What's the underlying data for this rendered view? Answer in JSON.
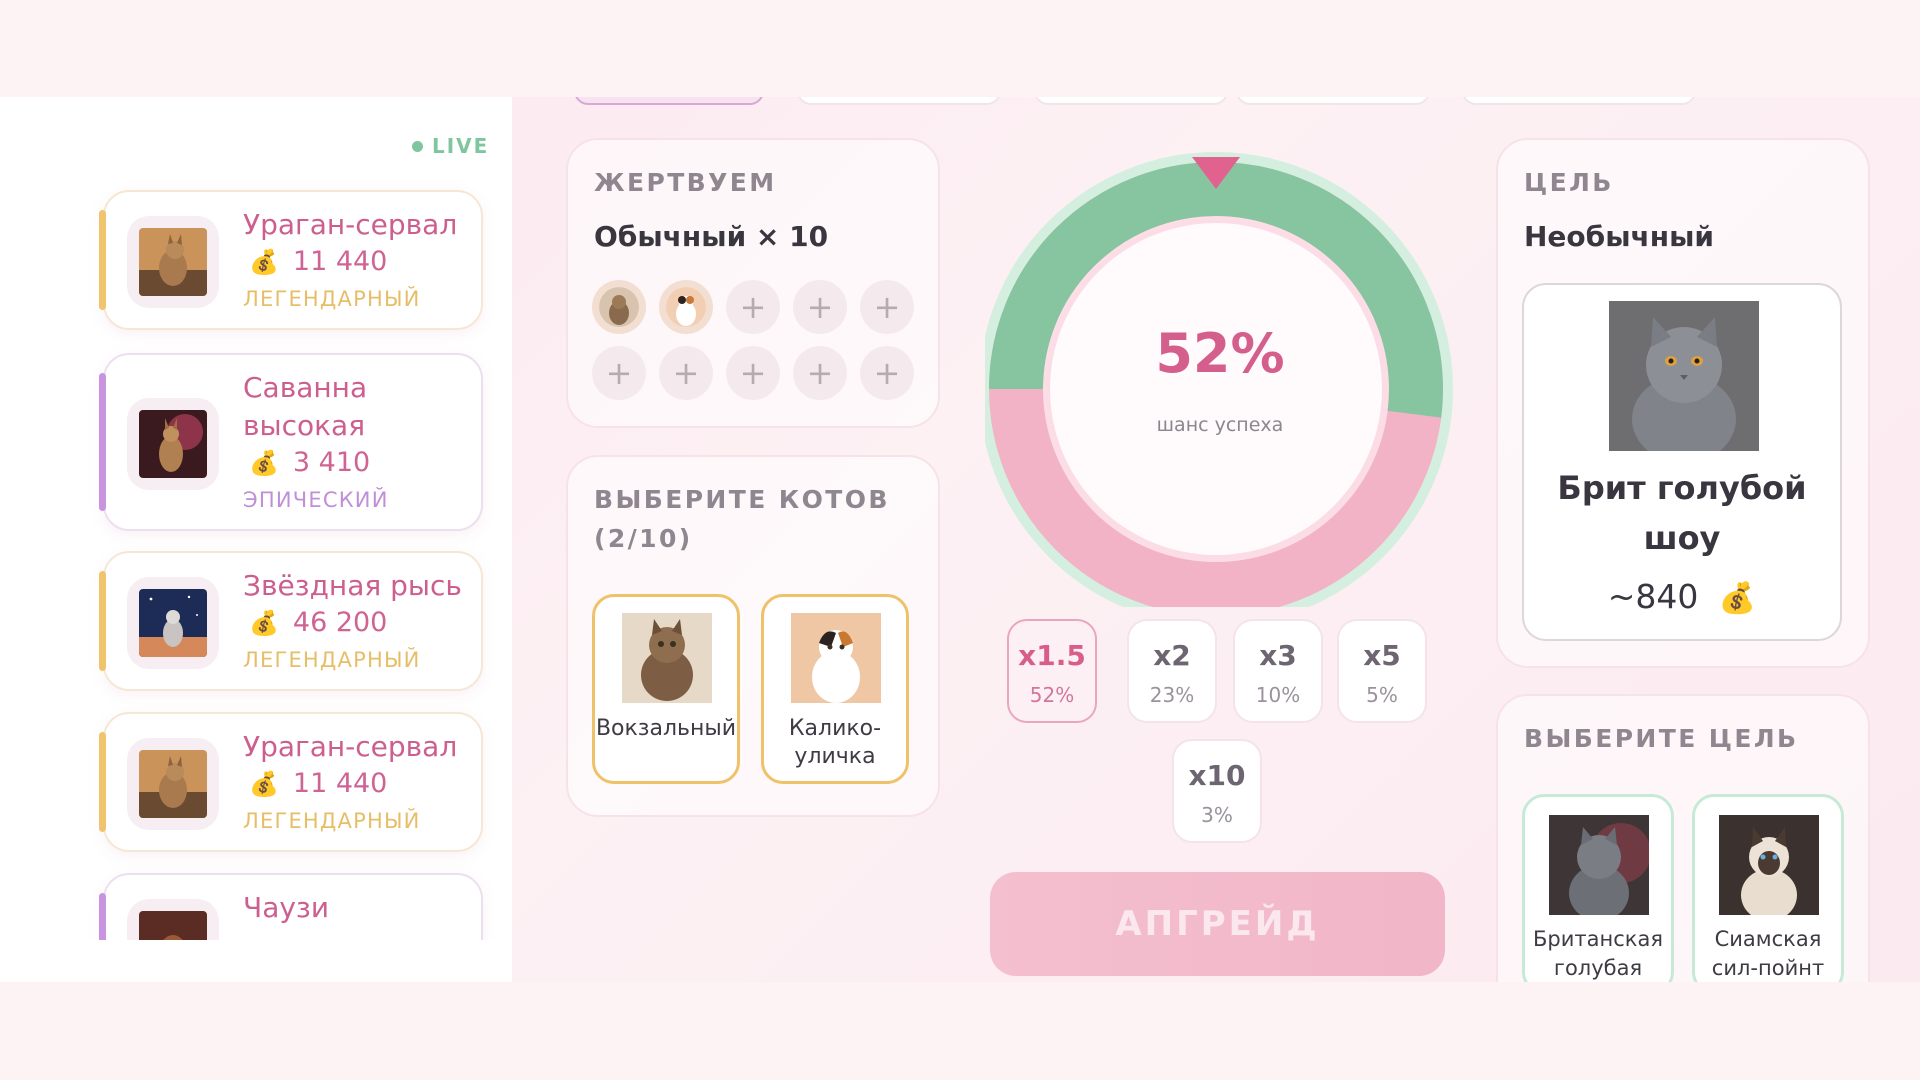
{
  "live": {
    "label": "LIVE"
  },
  "feed": [
    {
      "name": "Ураган-сервал",
      "price": "11 440",
      "rarity": "ЛЕГЕНДАРНЫЙ",
      "tier": "legendary"
    },
    {
      "name": "Саванна высокая",
      "price": "3 410",
      "rarity": "ЭПИЧЕСКИЙ",
      "tier": "epic"
    },
    {
      "name": "Звёздная рысь",
      "price": "46 200",
      "rarity": "ЛЕГЕНДАРНЫЙ",
      "tier": "legendary"
    },
    {
      "name": "Ураган-сервал",
      "price": "11 440",
      "rarity": "ЛЕГЕНДАРНЫЙ",
      "tier": "legendary"
    },
    {
      "name": "Чаузи",
      "price": "",
      "rarity": "",
      "tier": "epic"
    }
  ],
  "sacrifice": {
    "title": "ЖЕРТВУЕМ",
    "summary": "Обычный × 10",
    "slot_plus": "+"
  },
  "choose_cats": {
    "title": "ВЫБЕРИТЕ КОТОВ",
    "count": "(2/10)",
    "cats": [
      {
        "name": "Вокзальный"
      },
      {
        "name": "Калико-\nуличка"
      }
    ]
  },
  "chance": {
    "percent": "52%",
    "label": "шанс успеха",
    "success_fraction": 0.52
  },
  "multipliers": [
    {
      "label": "x1.5",
      "pct": "52%"
    },
    {
      "label": "x2",
      "pct": "23%"
    },
    {
      "label": "x3",
      "pct": "10%"
    },
    {
      "label": "x5",
      "pct": "5%"
    },
    {
      "label": "x10",
      "pct": "3%"
    }
  ],
  "upgrade_button": "АПГРЕЙД",
  "target": {
    "title": "ЦЕЛЬ",
    "rarity": "Необычный",
    "name": "Брит голубой\nшоу",
    "price": "~840"
  },
  "choose_target": {
    "title": "ВЫБЕРИТЕ ЦЕЛЬ",
    "cats": [
      {
        "name": "Британская\nголубая"
      },
      {
        "name": "Сиамская\nсил-пойнт"
      }
    ]
  },
  "colors": {
    "success": "#86c5a0",
    "fail": "#f2b3c6",
    "accent": "#d55f8c",
    "legendary": "#efc46c",
    "epic": "#c894df"
  },
  "icons": {
    "money": "money-bag-icon",
    "pointer": "triangle-pointer-icon"
  }
}
